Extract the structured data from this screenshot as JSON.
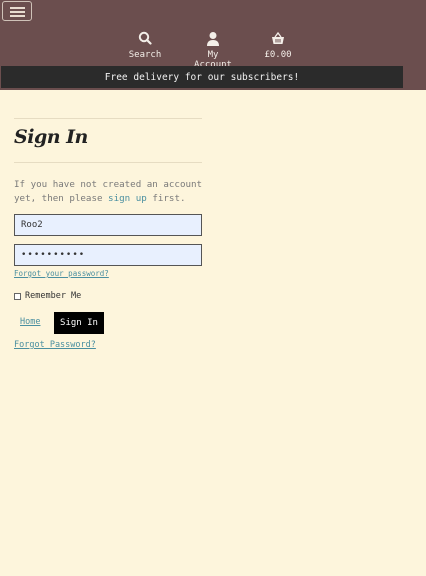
{
  "header": {
    "menu_icon": "hamburger-icon",
    "nav": [
      {
        "label": "Search",
        "icon": "search-icon"
      },
      {
        "label": "My Account",
        "icon": "user-icon"
      },
      {
        "label": "£0.00",
        "icon": "basket-icon"
      }
    ],
    "banner": "Free delivery for our subscribers!"
  },
  "main": {
    "title": "Sign In",
    "intro_before": "If you have not created an account yet, then please ",
    "intro_link": "sign up",
    "intro_after": " first.",
    "username_value": "Roo2",
    "password_value": "••••••••••",
    "forgot_small": "Forgot your password?",
    "remember_label": "Remember Me",
    "home_label": "Home",
    "signin_label": "Sign In",
    "forgot_bottom": "Forgot Password?"
  },
  "colors": {
    "header_bg": "#6b4e4e",
    "banner_bg": "#2b2b2b",
    "page_bg": "#fdf5dc",
    "link": "#4a8fa0",
    "field_bg": "#e8f0fe"
  }
}
